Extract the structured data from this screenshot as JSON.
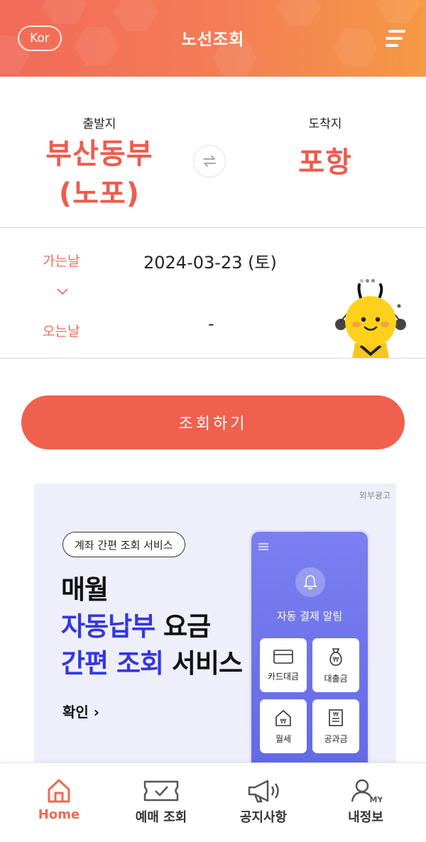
{
  "header": {
    "lang_button": "Kor",
    "title": "노선조회"
  },
  "route": {
    "departure_label": "출발지",
    "departure_line1": "부산동부",
    "departure_line2": "(노포)",
    "arrival_label": "도착지",
    "arrival_name": "포항"
  },
  "dates": {
    "go_label": "가는날",
    "go_value": "2024-03-23 (토)",
    "return_label": "오는날",
    "return_value": "-"
  },
  "search_button": "조회하기",
  "ad": {
    "tag": "외부광고",
    "pill": "계좌 간편 조회 서비스",
    "line1": "매월",
    "line2_blue": "자동납부",
    "line2_dark": " 요금",
    "line3_blue": "간편 조회",
    "line3_dark": " 서비스",
    "cta": "확인 ›",
    "phone_title": "자동 결제 알림",
    "tiles": [
      "카드대금",
      "대출금",
      "월세",
      "공과금"
    ]
  },
  "bottom_nav": [
    {
      "label": "Home",
      "active": true
    },
    {
      "label": "예매 조회",
      "active": false
    },
    {
      "label": "공지사항",
      "active": false
    },
    {
      "label": "내정보",
      "active": false
    }
  ],
  "colors": {
    "accent": "#f0604f",
    "ad_blue": "#3337e0",
    "nav_active": "#ee6a4f"
  }
}
